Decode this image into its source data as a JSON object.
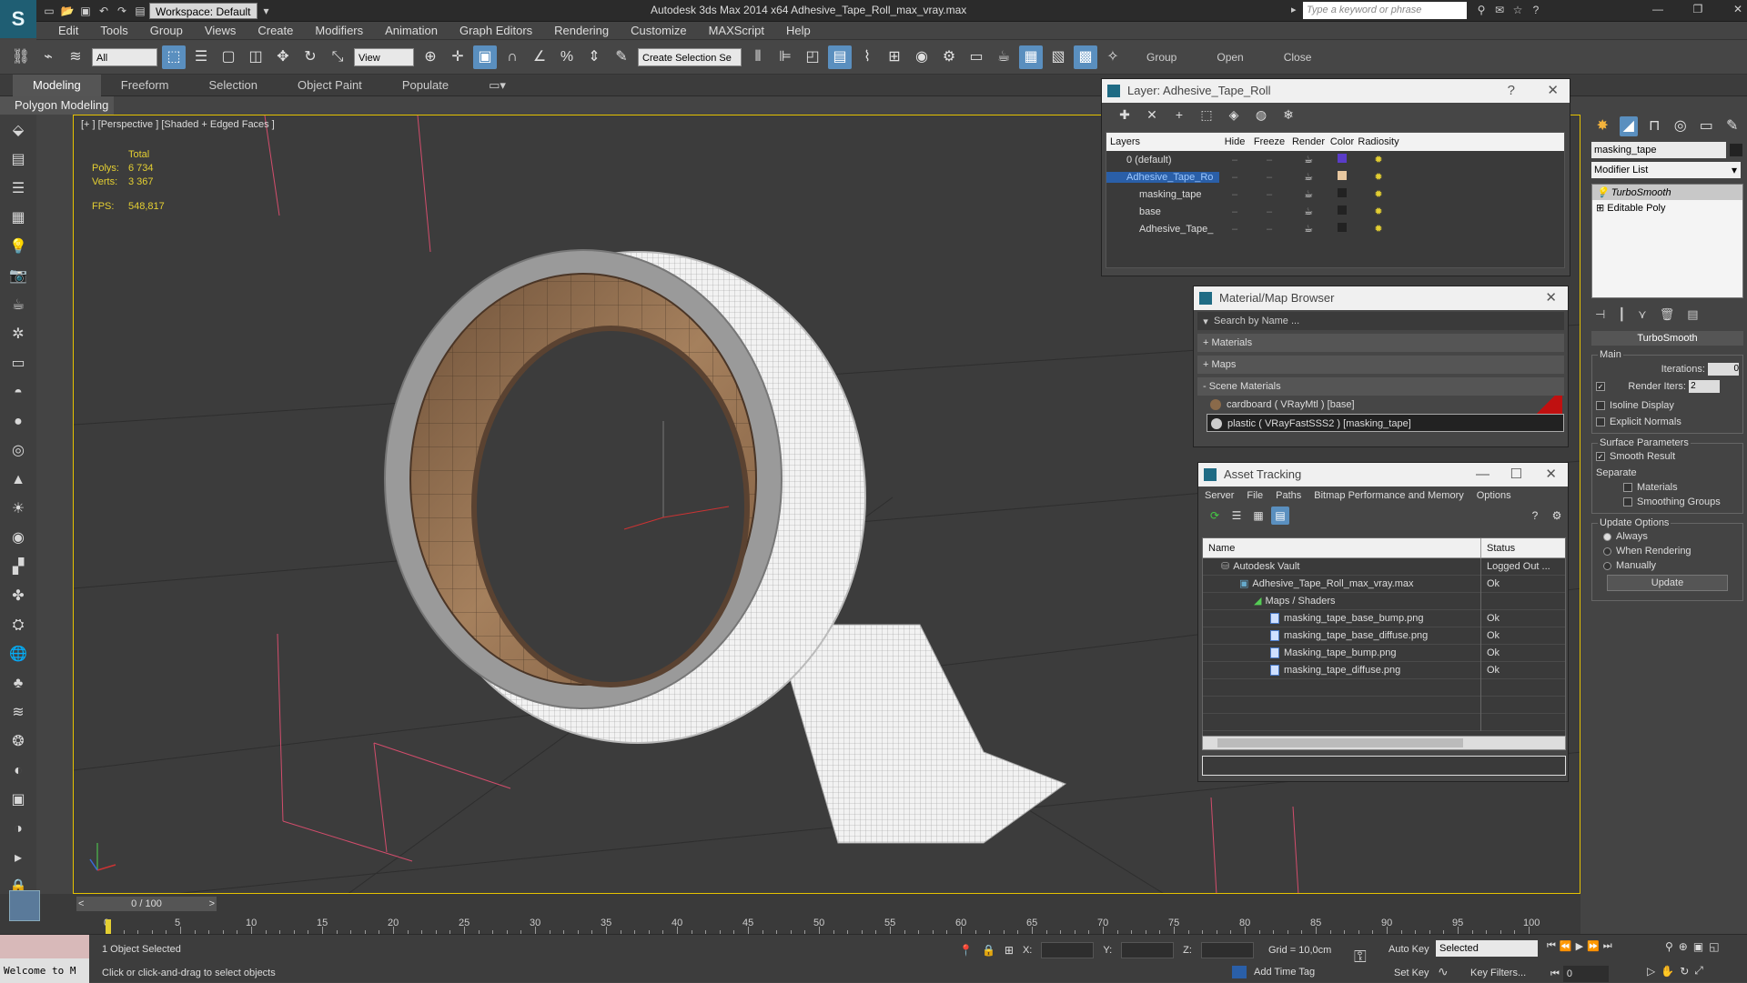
{
  "app": {
    "title": "Autodesk 3ds Max  2014 x64     Adhesive_Tape_Roll_max_vray.max",
    "workspace": "Workspace: Default",
    "search_placeholder": "Type a keyword or phrase"
  },
  "menus": [
    "Edit",
    "Tools",
    "Group",
    "Views",
    "Create",
    "Modifiers",
    "Animation",
    "Graph Editors",
    "Rendering",
    "Customize",
    "MAXScript",
    "Help"
  ],
  "toolbar": {
    "filter": "All",
    "ref_coord": "View",
    "selection_set": "Create Selection Se",
    "group_label": "Group",
    "open_label": "Open",
    "close_label": "Close"
  },
  "ribbon": {
    "tabs": [
      "Modeling",
      "Freeform",
      "Selection",
      "Object Paint",
      "Populate"
    ],
    "active_panel": "Polygon Modeling"
  },
  "viewport": {
    "label": "[+ ] [Perspective ] [Shaded + Edged Faces ]",
    "stats": {
      "total_label": "Total",
      "polys_label": "Polys:",
      "polys": "6 734",
      "verts_label": "Verts:",
      "verts": "3 367",
      "fps_label": "FPS:",
      "fps": "548,817"
    }
  },
  "layer_window": {
    "title": "Layer: Adhesive_Tape_Roll",
    "columns": [
      "Layers",
      "Hide",
      "Freeze",
      "Render",
      "Color",
      "Radiosity"
    ],
    "rows": [
      {
        "name": "0 (default)",
        "color": "#5a3cc8",
        "selected": false
      },
      {
        "name": "Adhesive_Tape_Ro",
        "color": "#e8c8a0",
        "selected": true
      },
      {
        "name": "masking_tape",
        "color": "#222222",
        "selected": false
      },
      {
        "name": "base",
        "color": "#222222",
        "selected": false
      },
      {
        "name": "Adhesive_Tape_",
        "color": "#222222",
        "selected": false
      }
    ]
  },
  "material_browser": {
    "title": "Material/Map Browser",
    "search_placeholder": "Search by Name ...",
    "sections": [
      "+ Materials",
      "+ Maps",
      "- Scene Materials"
    ],
    "materials": [
      "cardboard  ( VRayMtl )  [base]",
      "plastic  ( VRayFastSSS2 )  [masking_tape]"
    ]
  },
  "asset_tracking": {
    "title": "Asset Tracking",
    "menu": [
      "Server",
      "File",
      "Paths",
      "Bitmap Performance and Memory",
      "Options"
    ],
    "columns": [
      "Name",
      "Status"
    ],
    "rows": [
      {
        "name": "Autodesk Vault",
        "status": "Logged Out ...",
        "indent": 1
      },
      {
        "name": "Adhesive_Tape_Roll_max_vray.max",
        "status": "Ok",
        "indent": 2
      },
      {
        "name": "Maps / Shaders",
        "status": "",
        "indent": 3
      },
      {
        "name": "masking_tape_base_bump.png",
        "status": "Ok",
        "indent": 4
      },
      {
        "name": "masking_tape_base_diffuse.png",
        "status": "Ok",
        "indent": 4
      },
      {
        "name": "Masking_tape_bump.png",
        "status": "Ok",
        "indent": 4
      },
      {
        "name": "masking_tape_diffuse.png",
        "status": "Ok",
        "indent": 4
      }
    ]
  },
  "command_panel": {
    "object_name": "masking_tape",
    "modifier_list": "Modifier List",
    "stack": [
      "TurboSmooth",
      "Editable Poly"
    ],
    "rollout_title": "TurboSmooth",
    "main_label": "Main",
    "iterations_label": "Iterations:",
    "iterations": "0",
    "render_iters_label": "Render Iters:",
    "render_iters": "2",
    "isoline": "Isoline Display",
    "explicit_normals": "Explicit Normals",
    "surface_label": "Surface Parameters",
    "smooth_result": "Smooth Result",
    "separate_label": "Separate",
    "materials": "Materials",
    "smoothing_groups": "Smoothing Groups",
    "update_label": "Update Options",
    "always": "Always",
    "when_rendering": "When Rendering",
    "manually": "Manually",
    "update_button": "Update"
  },
  "timeline": {
    "slider": "0 / 100",
    "ticks": [
      "0",
      "5",
      "10",
      "15",
      "20",
      "25",
      "30",
      "35",
      "40",
      "45",
      "50",
      "55",
      "60",
      "65",
      "70",
      "75",
      "80",
      "85",
      "90",
      "95",
      "100"
    ]
  },
  "status": {
    "welcome": "Welcome to M",
    "selection": "1 Object Selected",
    "prompt": "Click or click-and-drag to select objects",
    "x_label": "X:",
    "y_label": "Y:",
    "z_label": "Z:",
    "grid": "Grid = 10,0cm",
    "add_time_tag": "Add Time Tag",
    "auto_key": "Auto Key",
    "set_key": "Set Key",
    "selected": "Selected",
    "key_filters": "Key Filters...",
    "frame": "0"
  },
  "colors": {
    "viewport_border": "#e5c200",
    "selection_blue": "#2a5fa8",
    "stats_yellow": "#e4cf32"
  }
}
